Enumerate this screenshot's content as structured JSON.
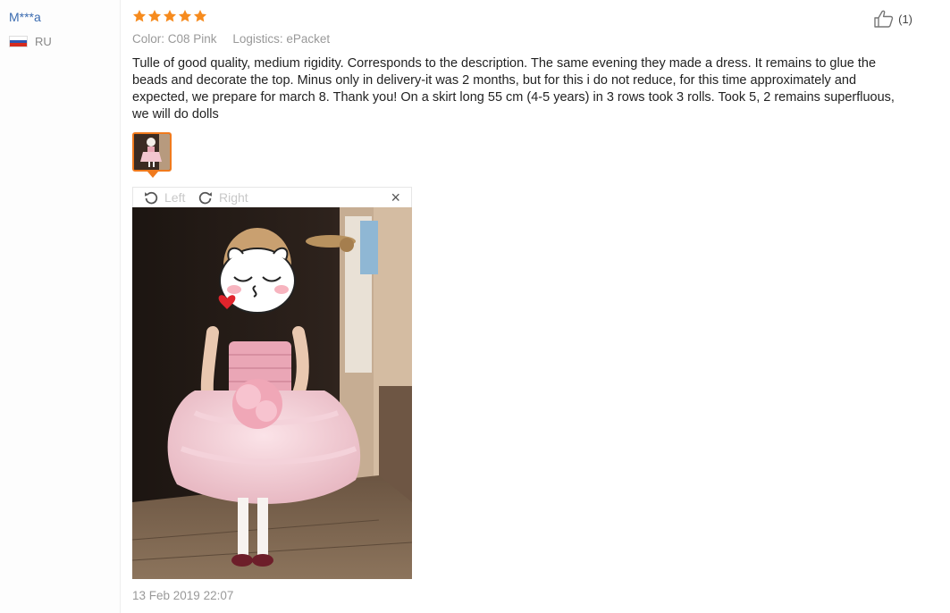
{
  "reviewer": {
    "name": "M***a",
    "country": "RU"
  },
  "review": {
    "rating": 5,
    "color_label": "Color: C08 Pink",
    "logistics_label": "Logistics: ePacket",
    "text": "Tulle of good quality, medium rigidity. Corresponds to the description. The same evening they made a dress. It remains to glue the beads and decorate the top. Minus only in delivery-it was 2 months, but for this i do not reduce, for this time approximately and expected, we prepare for march 8. Thank you! On a skirt long 55 cm (4-5 years) in 3 rows took 3 rolls. Took 5, 2 remains superfluous, we will do dolls",
    "helpful_count": "(1)",
    "date": "13 Feb 2019 22:07"
  },
  "viewer": {
    "rotate_left": "Left",
    "rotate_right": "Right",
    "close": "×"
  },
  "colors": {
    "star": "#f68b1e",
    "accent": "#f07a1d",
    "link": "#3a6bb0"
  },
  "icons": {
    "rating": "star-icon",
    "helpful": "thumbs-up-icon",
    "rotate_left": "rotate-left-icon",
    "rotate_right": "rotate-right-icon",
    "close": "close-icon"
  }
}
